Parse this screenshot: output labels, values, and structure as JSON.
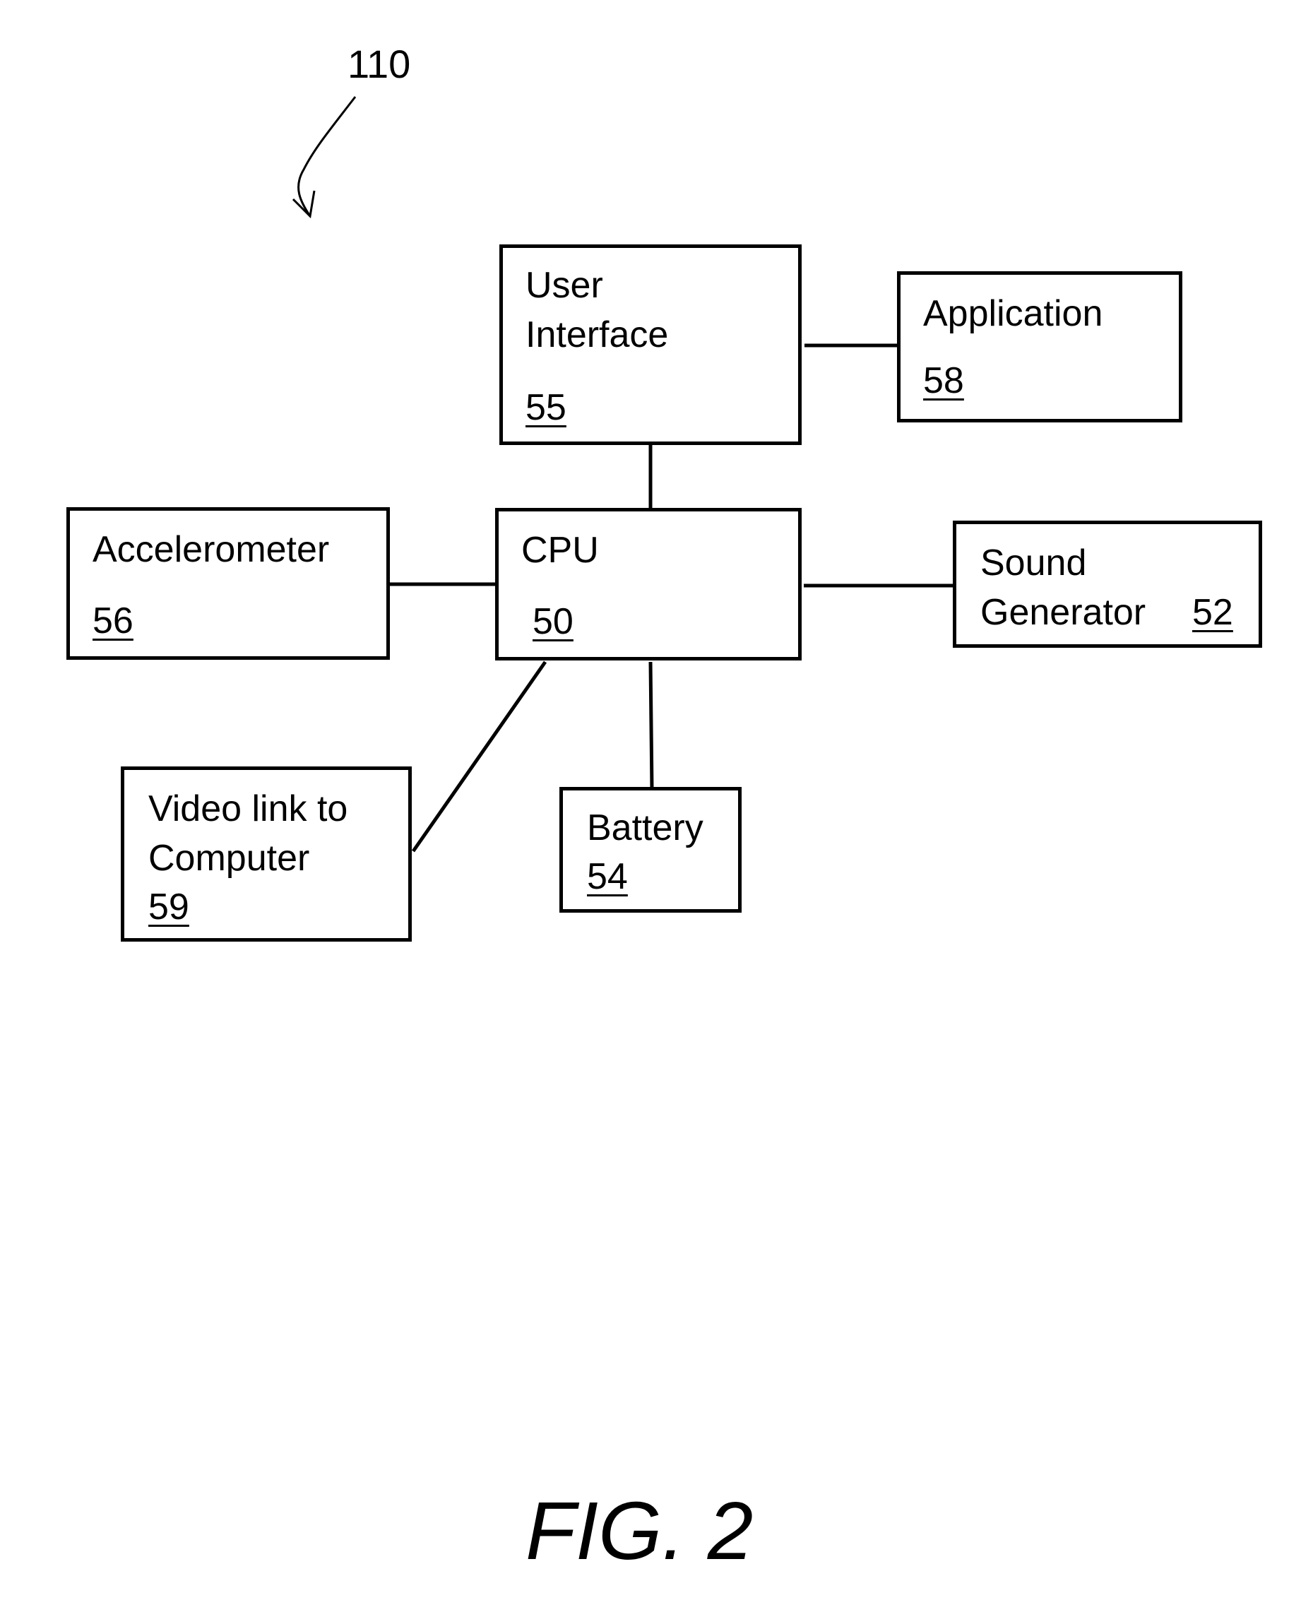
{
  "figure": {
    "reference": "110",
    "caption": "FIG. 2"
  },
  "blocks": {
    "user_interface": {
      "label": "User\nInterface",
      "number": "55"
    },
    "application": {
      "label": "Application",
      "number": "58"
    },
    "accelerometer": {
      "label": "Accelerometer",
      "number": "56"
    },
    "cpu": {
      "label": "CPU",
      "number": "50"
    },
    "sound_generator": {
      "label": "Sound\nGenerator",
      "number": "52"
    },
    "video_link": {
      "label": "Video link to\nComputer",
      "number": "59"
    },
    "battery": {
      "label": "Battery",
      "number": "54"
    }
  },
  "connections": [
    {
      "from": "user_interface",
      "to": "application"
    },
    {
      "from": "user_interface",
      "to": "cpu"
    },
    {
      "from": "accelerometer",
      "to": "cpu"
    },
    {
      "from": "cpu",
      "to": "sound_generator"
    },
    {
      "from": "cpu",
      "to": "video_link"
    },
    {
      "from": "cpu",
      "to": "battery"
    }
  ]
}
